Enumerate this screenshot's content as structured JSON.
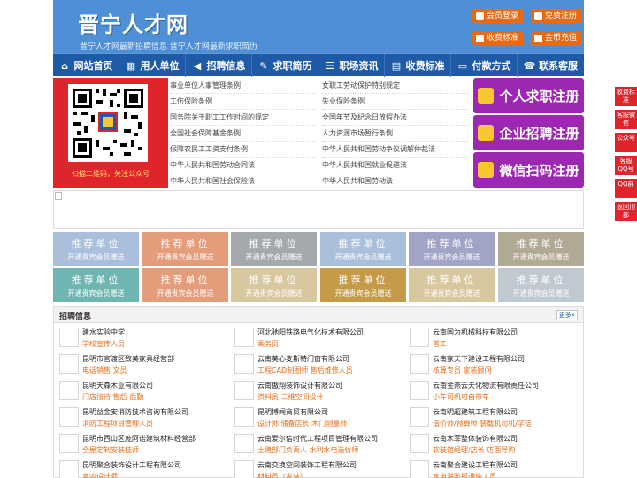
{
  "header": {
    "site_name": "晋宁人才网",
    "slogan": "晋宁人才网最新招聘信息   晋宁人才网最新求职简历",
    "buttons": [
      {
        "label": "会员登录",
        "icon": "user-icon"
      },
      {
        "label": "免费注册",
        "icon": "register-icon"
      },
      {
        "label": "收费标准",
        "icon": "price-icon"
      },
      {
        "label": "金币充值",
        "icon": "coin-icon"
      }
    ]
  },
  "nav": [
    {
      "label": "网站首页",
      "icon": "home-icon"
    },
    {
      "label": "用人单位",
      "icon": "building-icon"
    },
    {
      "label": "招聘信息",
      "icon": "megaphone-icon"
    },
    {
      "label": "求职简历",
      "icon": "resume-icon"
    },
    {
      "label": "职场资讯",
      "icon": "news-icon"
    },
    {
      "label": "收费标准",
      "icon": "ticket-icon"
    },
    {
      "label": "付款方式",
      "icon": "card-icon"
    },
    {
      "label": "联系客服",
      "icon": "phone-icon"
    }
  ],
  "qr": {
    "caption": "扫描二维码，关注公众号"
  },
  "links_left": [
    "事业单位人事管理条例",
    "工伤保险条例",
    "国务院关于职工工作时间的规定",
    "全国社会保障基金条例",
    "保障农民工工资支付条例",
    "中华人民共和国劳动合同法",
    "中华人民共和国社会保险法"
  ],
  "links_right": [
    "女职工劳动保护特别规定",
    "失业保险条例",
    "全国年节及纪念日放假办法",
    "人力资源市场暂行条例",
    "中华人民共和国劳动争议调解仲裁法",
    "中华人民共和国就业促进法",
    "中华人民共和国劳动法"
  ],
  "register": [
    {
      "label": "个人求职注册",
      "icon": "person-icon"
    },
    {
      "label": "企业招聘注册",
      "icon": "company-icon"
    },
    {
      "label": "微信扫码注册",
      "icon": "wechat-icon"
    }
  ],
  "tiles": {
    "title": "推荐单位",
    "subtitle": "开通贵宾会员赠送",
    "colors": [
      "#a9bfdc",
      "#e59c7b",
      "#a3a9ad",
      "#a9bfdc",
      "#a1a4c6",
      "#b2a995",
      "#6fb6b3",
      "#e59c7b",
      "#d8c8a0",
      "#c59a48",
      "#d8c8a0",
      "#c0c9d2",
      "#c9c9c9"
    ]
  },
  "jobs": {
    "title": "招聘信息",
    "more_label": "更多»",
    "columns": [
      [
        {
          "company": "建水实验中学",
          "positions": "学校宣传人员"
        },
        {
          "company": "昆明市官渡区致美家具经营部",
          "positions": "电话销售 文员"
        },
        {
          "company": "昆明天森木业有限公司",
          "positions": "门店接待 售后-后勤"
        },
        {
          "company": "昆明益金安消防技术咨询有限公司",
          "positions": "消防工程项目管理人员"
        },
        {
          "company": "昆明市西山区庞阿诺建筑材料经营部",
          "positions": "全屋定制安装技师"
        },
        {
          "company": "昆明聚合装饰设计工程有限公司",
          "positions": "室内设计师"
        }
      ],
      [
        {
          "company": "河北驰阳铁路电气化技术有限公司",
          "positions": "乘务员"
        },
        {
          "company": "云南美心麦斯特门窗有限公司",
          "positions": "工程CAD制图师 售后维修人员"
        },
        {
          "company": "云南傲翔装饰设计有限公司",
          "positions": "资料员 三维空间设计"
        },
        {
          "company": "昆明博闻商贸有限公司",
          "positions": "设计师 储备店长 木门测量师"
        },
        {
          "company": "云南爱尔信时代工程项目管理有限公司",
          "positions": "土建部门负责人 水利水电造价师"
        },
        {
          "company": "云南交换空间装饰工程有限公司",
          "positions": "材料员（家装）"
        }
      ],
      [
        {
          "company": "云南国为机械科技有限公司",
          "positions": "普工"
        },
        {
          "company": "云南家天下建设工程有限公司",
          "positions": "核算专员 家装顾问"
        },
        {
          "company": "云南金燕云天化物流有限责任公司",
          "positions": "小车司机可自带车"
        },
        {
          "company": "云南明超建筑工程有限公司",
          "positions": "造价师/预算师 装载机司机/学徒"
        },
        {
          "company": "云南木菲整体装饰有限公司",
          "positions": "软装馆经理/店长 店面导购"
        },
        {
          "company": "云南聚合建设工程有限公司",
          "positions": "水电消防报通施工员"
        }
      ]
    ]
  },
  "float_bar": [
    "收费标准",
    "客服微信",
    "公众号",
    "客服QQ号",
    "QQ群",
    "返回顶部"
  ],
  "colors": {
    "brand_blue": "#1f5aa6",
    "header_blue": "#4e8fd6",
    "accent_orange": "#e86a13",
    "register_purple": "#9c27b0",
    "float_red": "#e0242b"
  }
}
